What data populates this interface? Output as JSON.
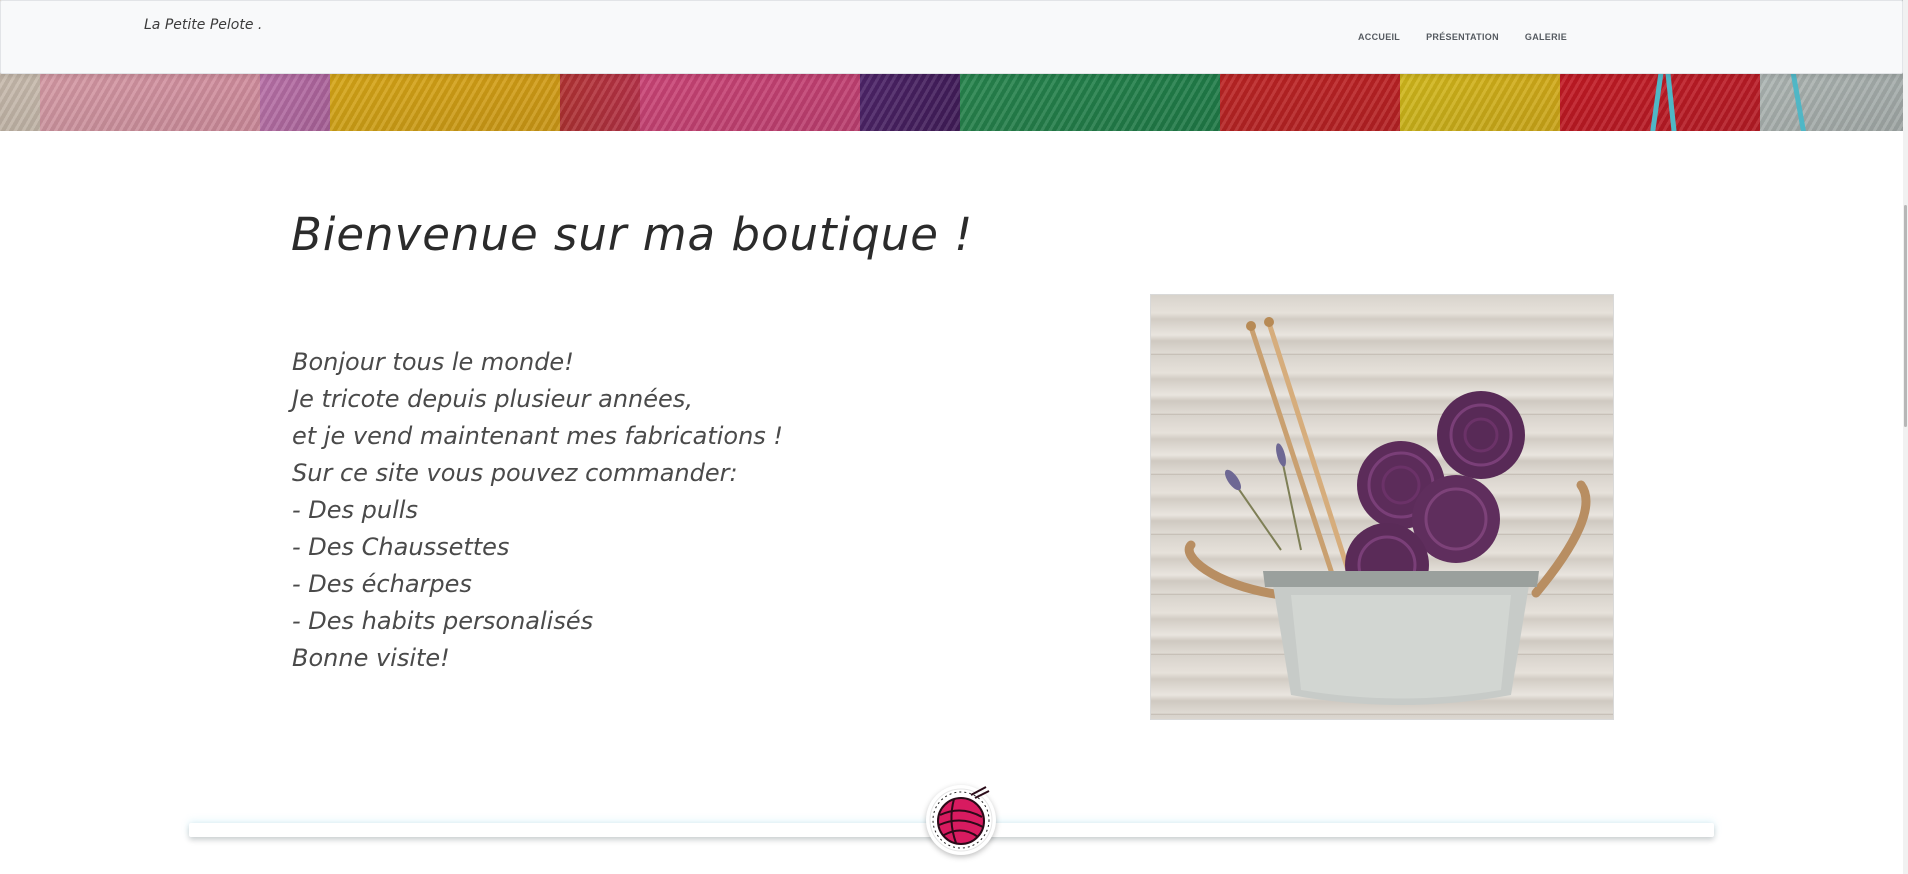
{
  "brand": {
    "name": "La Petite Pelote ."
  },
  "nav": {
    "items": [
      {
        "label": "ACCUEIL"
      },
      {
        "label": "PRÉSENTATION"
      },
      {
        "label": "GALERIE"
      }
    ]
  },
  "main": {
    "title": "Bienvenue sur ma boutique !",
    "intro_lines": [
      "Bonjour tous le monde!",
      "Je tricote depuis plusieur années,",
      "et je vend maintenant mes fabrications !",
      "Sur ce site vous pouvez commander:",
      "- Des pulls",
      "- Des Chaussettes",
      "- Des écharpes",
      "- Des habits personalisés",
      "Bonne visite!"
    ]
  },
  "colors": {
    "navbar_bg": "#f8f9fa",
    "text_dark": "#2b2b2b",
    "logo_yarn": "#d81b60"
  },
  "icons": {
    "logo": "yarn-ball-icon",
    "photo": "yarn-bucket-photo"
  }
}
